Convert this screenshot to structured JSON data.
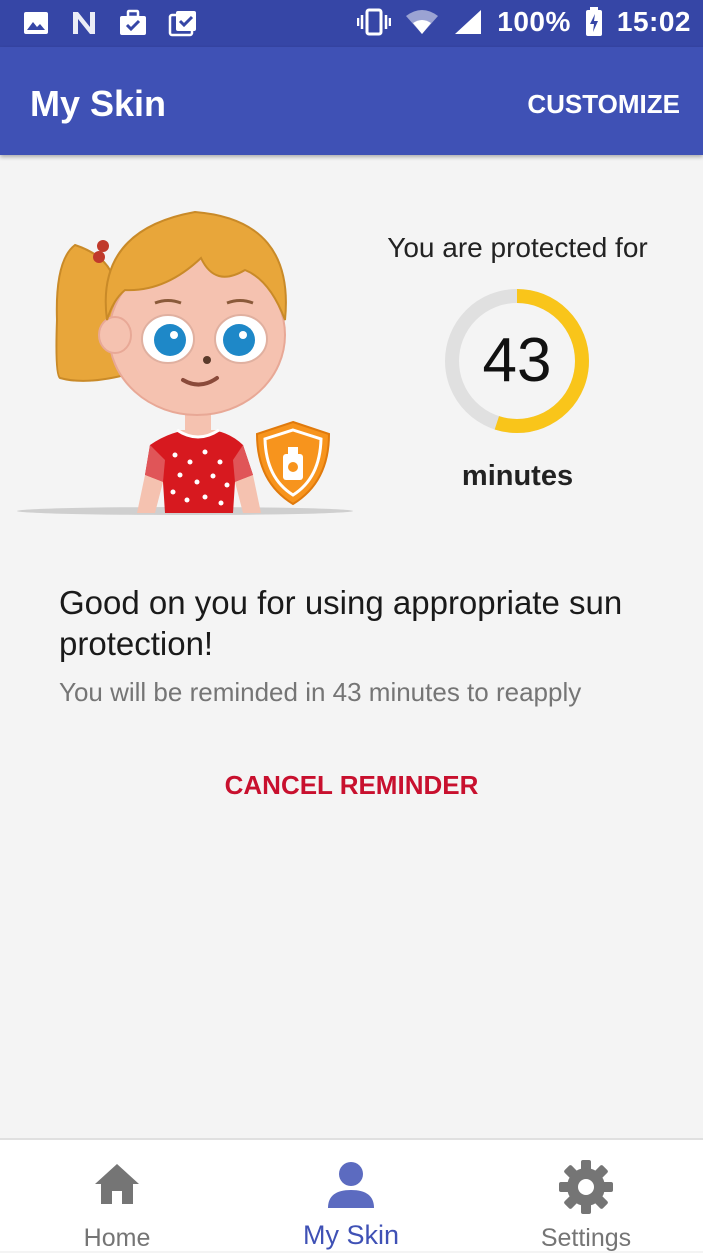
{
  "status_bar": {
    "battery": "100%",
    "time": "15:02",
    "icons": [
      "image-icon",
      "n-icon",
      "briefcase-check-icon",
      "clipboard-check-icon",
      "vibrate-icon",
      "wifi-icon",
      "signal-icon",
      "battery-charging-icon"
    ]
  },
  "app_bar": {
    "title": "My Skin",
    "action": "CUSTOMIZE"
  },
  "protection": {
    "label": "You are protected for",
    "value": "43",
    "unit": "minutes",
    "progress_fraction": 0.55,
    "colors": {
      "ring_fill": "#f9c51a",
      "ring_track": "#e0e0e0"
    }
  },
  "message": {
    "title": "Good on you for using appropriate sun protection!",
    "subtitle": "You will be reminded in 43 minutes to reapply"
  },
  "actions": {
    "cancel_reminder": "CANCEL REMINDER"
  },
  "bottom_nav": {
    "items": [
      {
        "label": "Home",
        "icon": "home-icon"
      },
      {
        "label": "My Skin",
        "icon": "person-icon",
        "active": true
      },
      {
        "label": "Settings",
        "icon": "gear-icon"
      }
    ]
  },
  "colors": {
    "primary": "#3f51b5",
    "primary_dark": "#3646a6",
    "accent_red": "#c8102e"
  }
}
